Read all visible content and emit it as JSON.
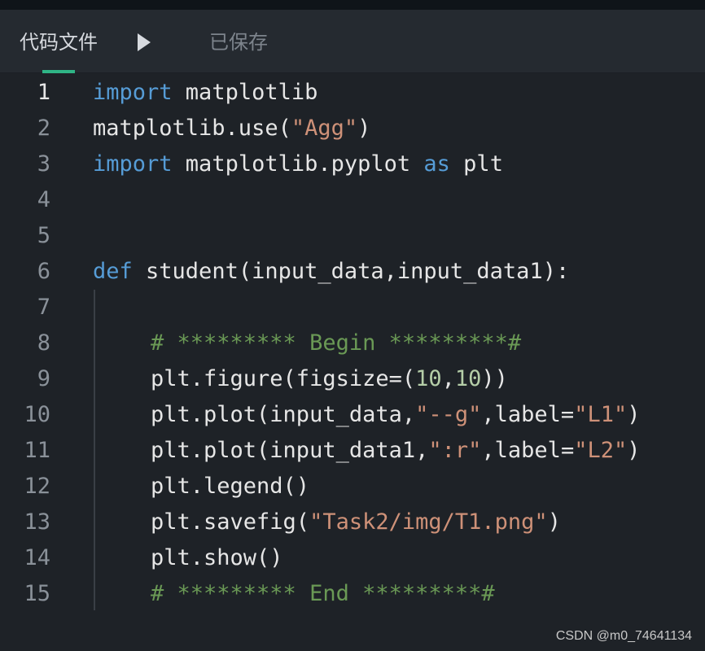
{
  "header": {
    "tab_label": "代码文件",
    "save_status": "已保存",
    "run_icon": "play-icon"
  },
  "editor": {
    "lines": [
      {
        "num": "1",
        "tokens": [
          {
            "t": "import",
            "c": "kw"
          },
          {
            "t": " matplotlib",
            "c": ""
          }
        ]
      },
      {
        "num": "2",
        "tokens": [
          {
            "t": "matplotlib.use(",
            "c": ""
          },
          {
            "t": "\"Agg\"",
            "c": "str"
          },
          {
            "t": ")",
            "c": ""
          }
        ]
      },
      {
        "num": "3",
        "tokens": [
          {
            "t": "import",
            "c": "kw"
          },
          {
            "t": " matplotlib.pyplot ",
            "c": ""
          },
          {
            "t": "as",
            "c": "kw"
          },
          {
            "t": " plt",
            "c": ""
          }
        ]
      },
      {
        "num": "4",
        "tokens": []
      },
      {
        "num": "5",
        "tokens": []
      },
      {
        "num": "6",
        "tokens": [
          {
            "t": "def",
            "c": "kw"
          },
          {
            "t": " student(input_data,input_data1):",
            "c": ""
          }
        ]
      },
      {
        "num": "7",
        "tokens": []
      },
      {
        "num": "8",
        "indent": true,
        "tokens": [
          {
            "t": "# ********* Begin *********#",
            "c": "cmt"
          }
        ]
      },
      {
        "num": "9",
        "indent": true,
        "tokens": [
          {
            "t": "plt.figure(figsize=(",
            "c": ""
          },
          {
            "t": "10",
            "c": "num"
          },
          {
            "t": ",",
            "c": ""
          },
          {
            "t": "10",
            "c": "num"
          },
          {
            "t": "))",
            "c": ""
          }
        ]
      },
      {
        "num": "10",
        "indent": true,
        "tokens": [
          {
            "t": "plt.plot(input_data,",
            "c": ""
          },
          {
            "t": "\"--g\"",
            "c": "str"
          },
          {
            "t": ",label=",
            "c": ""
          },
          {
            "t": "\"L1\"",
            "c": "str"
          },
          {
            "t": ")",
            "c": ""
          }
        ]
      },
      {
        "num": "11",
        "indent": true,
        "tokens": [
          {
            "t": "plt.plot(input_data1,",
            "c": ""
          },
          {
            "t": "\":r\"",
            "c": "str"
          },
          {
            "t": ",label=",
            "c": ""
          },
          {
            "t": "\"L2\"",
            "c": "str"
          },
          {
            "t": ")",
            "c": ""
          }
        ]
      },
      {
        "num": "12",
        "indent": true,
        "tokens": [
          {
            "t": "plt.legend()",
            "c": ""
          }
        ]
      },
      {
        "num": "13",
        "indent": true,
        "tokens": [
          {
            "t": "plt.savefig(",
            "c": ""
          },
          {
            "t": "\"Task2/img/T1.png\"",
            "c": "str"
          },
          {
            "t": ")",
            "c": ""
          }
        ]
      },
      {
        "num": "14",
        "indent": true,
        "tokens": [
          {
            "t": "plt.show()",
            "c": ""
          }
        ]
      },
      {
        "num": "15",
        "indent": true,
        "tokens": [
          {
            "t": "# ********* End *********#",
            "c": "cmt"
          }
        ]
      }
    ]
  },
  "watermark": "CSDN @m0_74641134",
  "colors": {
    "accent": "#2fb586",
    "keyword": "#569cd6",
    "string": "#ce9178",
    "number": "#b5cea8",
    "comment": "#6a9955"
  }
}
